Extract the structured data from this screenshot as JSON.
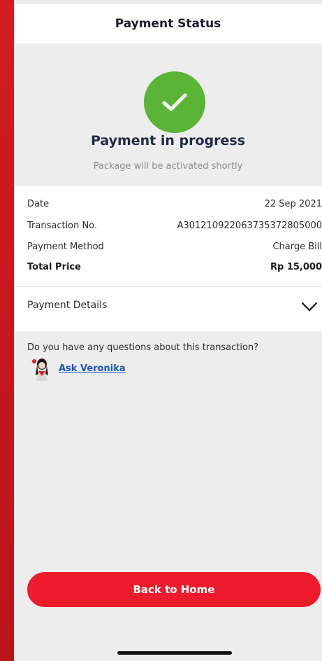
{
  "header": {
    "title": "Payment Status"
  },
  "status": {
    "icon": "check-icon",
    "icon_color": "#5ab435",
    "title": "Payment in progress",
    "subtitle": "Package will be activated shortly"
  },
  "transaction": {
    "rows": [
      {
        "label": "Date",
        "value": "22 Sep 2021"
      },
      {
        "label": "Transaction No.",
        "value": "A301210922063735372805000"
      },
      {
        "label": "Payment Method",
        "value": "Charge Bill"
      },
      {
        "label": "Total Price",
        "value": "Rp 15,000"
      }
    ]
  },
  "payment_details": {
    "label": "Payment Details",
    "icon": "chevron-down-icon"
  },
  "help": {
    "question": "Do you have any questions about this transaction?",
    "link_label": "Ask Veronika"
  },
  "actions": {
    "back_label": "Back to Home"
  },
  "colors": {
    "brand_red": "#ee1b2d",
    "link_blue": "#1a56c4"
  }
}
